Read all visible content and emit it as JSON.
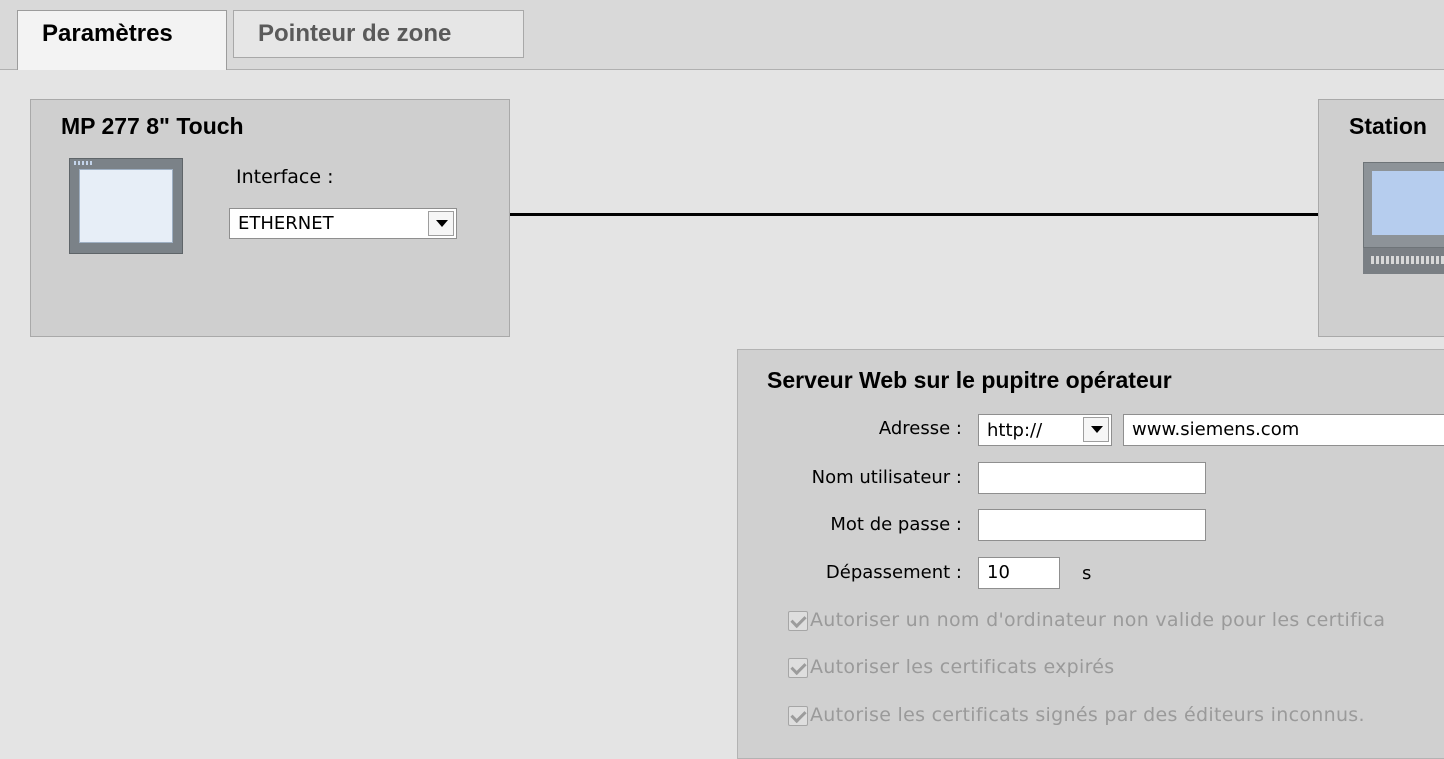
{
  "tabs": [
    {
      "label": "Paramètres",
      "active": true
    },
    {
      "label": "Pointeur de zone",
      "active": false
    }
  ],
  "left_device": {
    "title": "MP 277 8\" Touch",
    "icon": "hmi-panel-icon",
    "interface_label": "Interface :",
    "interface_value": "ETHERNET"
  },
  "right_device": {
    "title": "Station",
    "icon": "pc-station-icon"
  },
  "web_server": {
    "title": "Serveur Web sur le pupitre opérateur",
    "address_label": "Adresse :",
    "protocol_value": "http://",
    "url_value": "www.siemens.com",
    "username_label": "Nom utilisateur :",
    "username_value": "",
    "password_label": "Mot de passe :",
    "password_value": "",
    "timeout_label": "Dépassement :",
    "timeout_value": "10",
    "timeout_unit": "s",
    "checkboxes": [
      {
        "label": "Autoriser un nom d'ordinateur non valide pour les certifica",
        "checked": true,
        "disabled": true
      },
      {
        "label": "Autoriser les certificats expirés",
        "checked": true,
        "disabled": true
      },
      {
        "label": "Autorise les certificats signés par des éditeurs inconnus.",
        "checked": true,
        "disabled": true
      }
    ]
  }
}
